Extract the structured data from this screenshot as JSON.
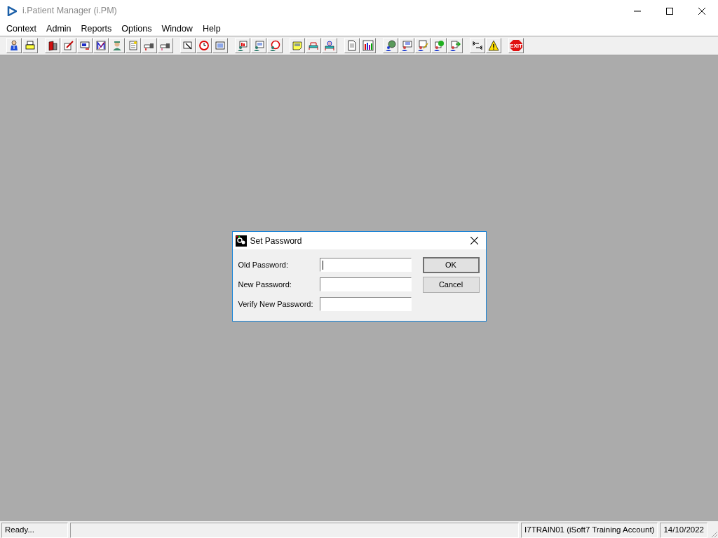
{
  "window": {
    "title": "i.Patient Manager (i.PM)",
    "active": false
  },
  "menu": [
    "Context",
    "Admin",
    "Reports",
    "Options",
    "Window",
    "Help"
  ],
  "exit_label": "EXIT",
  "dialog": {
    "title": "Set Password",
    "fields": [
      {
        "label": "Old Password:",
        "focused": true
      },
      {
        "label": "New Password:",
        "focused": false
      },
      {
        "label": "Verify New Password:",
        "focused": false
      }
    ],
    "buttons": [
      {
        "label": "OK",
        "default": true
      },
      {
        "label": "Cancel",
        "default": false
      }
    ]
  },
  "status_bar": {
    "message": "Ready...",
    "user": "I7TRAIN01 (iSoft7 Training Account)",
    "date": "14/10/2022"
  }
}
